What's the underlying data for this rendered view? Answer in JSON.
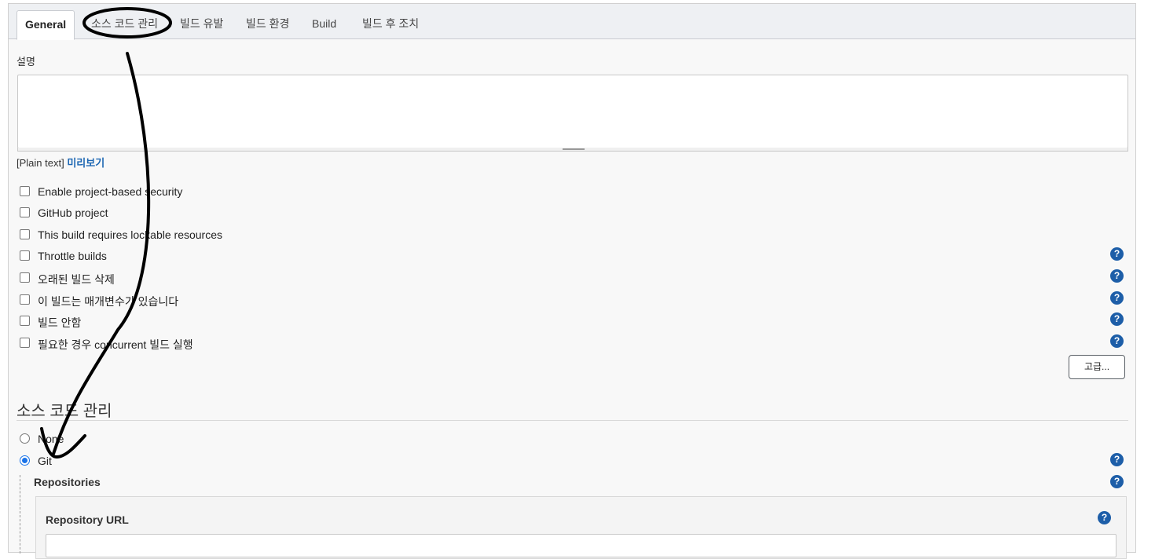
{
  "tabs": [
    {
      "label": "General",
      "active": true
    },
    {
      "label": "소스 코드 관리",
      "active": false
    },
    {
      "label": "빌드 유발",
      "active": false
    },
    {
      "label": "빌드 환경",
      "active": false
    },
    {
      "label": "Build",
      "active": false
    },
    {
      "label": "빌드 후 조치",
      "active": false
    }
  ],
  "description": {
    "label": "설명",
    "value": "",
    "format_text": "[Plain text]",
    "preview_link": "미리보기"
  },
  "options": [
    {
      "label": "Enable project-based security",
      "checked": false,
      "help": false
    },
    {
      "label": "GitHub project",
      "checked": false,
      "help": false
    },
    {
      "label": "This build requires lockable resources",
      "checked": false,
      "help": false
    },
    {
      "label": "Throttle builds",
      "checked": false,
      "help": true
    },
    {
      "label": "오래된 빌드 삭제",
      "checked": false,
      "help": true
    },
    {
      "label": "이 빌드는 매개변수가 있습니다",
      "checked": false,
      "help": true
    },
    {
      "label": "빌드 안함",
      "checked": false,
      "help": true
    },
    {
      "label": "필요한 경우 concurrent 빌드 실행",
      "checked": false,
      "help": true
    }
  ],
  "advanced_button": "고급...",
  "scm": {
    "title": "소스 코드 관리",
    "choices": [
      {
        "label": "None",
        "selected": false
      },
      {
        "label": "Git",
        "selected": true
      }
    ],
    "repositories_label": "Repositories",
    "repository_url_label": "Repository URL",
    "repository_url_value": ""
  },
  "help_glyph": "?",
  "colors": {
    "help_icon": "#1d5ea8",
    "link": "#1d67b3",
    "radio_selected": "#1a73e8",
    "annotation": "#000000"
  }
}
